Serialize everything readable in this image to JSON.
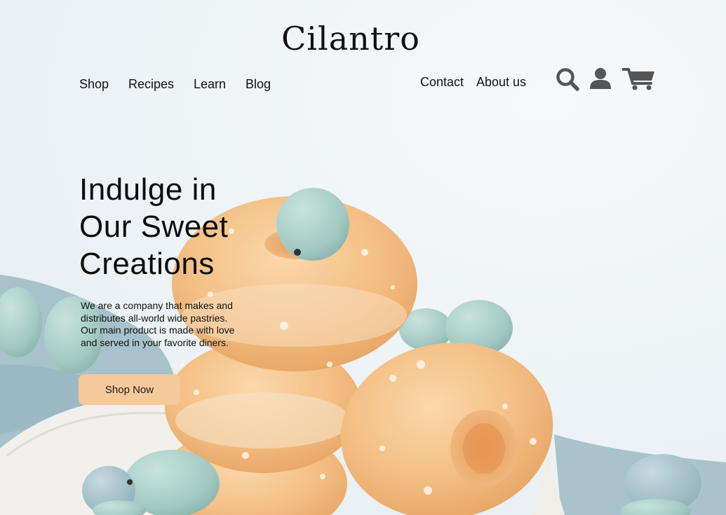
{
  "brand": {
    "logo_text": "Cilantro"
  },
  "nav": {
    "left": [
      "Shop",
      "Recipes",
      "Learn",
      "Blog"
    ],
    "right": [
      "Contact",
      "About us"
    ]
  },
  "icons": [
    "search-icon",
    "user-icon",
    "cart-icon"
  ],
  "hero": {
    "headline_lines": [
      "Indulge in",
      "Our Sweet",
      "Creations"
    ],
    "description": "We are a company that makes and distributes all-world wide pastries. Our main product is made with love and served in your favorite diners.",
    "cta_label": "Shop Now"
  },
  "colors": {
    "background": "#eef3f6",
    "cta": "#f5c99b",
    "icon": "#555555",
    "cloth": "#a9c2ca",
    "egg": "#a9cdc6"
  }
}
